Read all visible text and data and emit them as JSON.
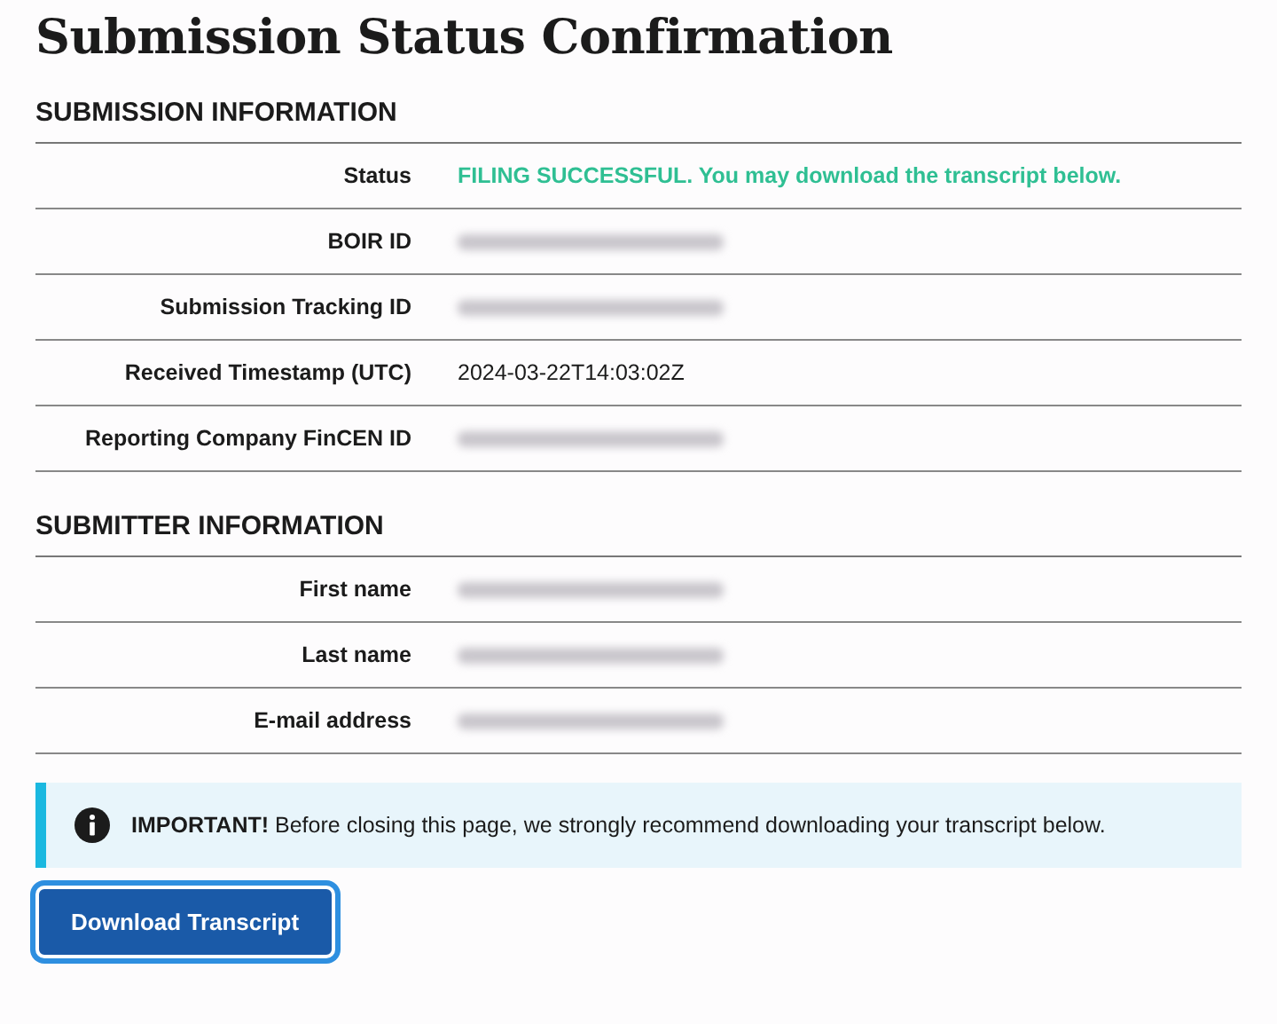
{
  "title": "Submission Status Confirmation",
  "sections": [
    {
      "heading": "SUBMISSION INFORMATION",
      "rows": [
        {
          "label": "Status",
          "kind": "status",
          "value": "FILING SUCCESSFUL. You may download the transcript below."
        },
        {
          "label": "BOIR ID",
          "kind": "redacted"
        },
        {
          "label": "Submission Tracking ID",
          "kind": "redacted"
        },
        {
          "label": "Received Timestamp (UTC)",
          "kind": "text",
          "value": "2024-03-22T14:03:02Z"
        },
        {
          "label": "Reporting Company FinCEN ID",
          "kind": "redacted"
        }
      ]
    },
    {
      "heading": "SUBMITTER INFORMATION",
      "rows": [
        {
          "label": "First name",
          "kind": "redacted"
        },
        {
          "label": "Last name",
          "kind": "redacted"
        },
        {
          "label": "E-mail address",
          "kind": "redacted"
        }
      ]
    }
  ],
  "alert": {
    "text": "**IMPORTANT!** Before closing this page, we strongly recommend downloading your transcript below."
  },
  "button": {
    "label": "Download Transcript"
  }
}
